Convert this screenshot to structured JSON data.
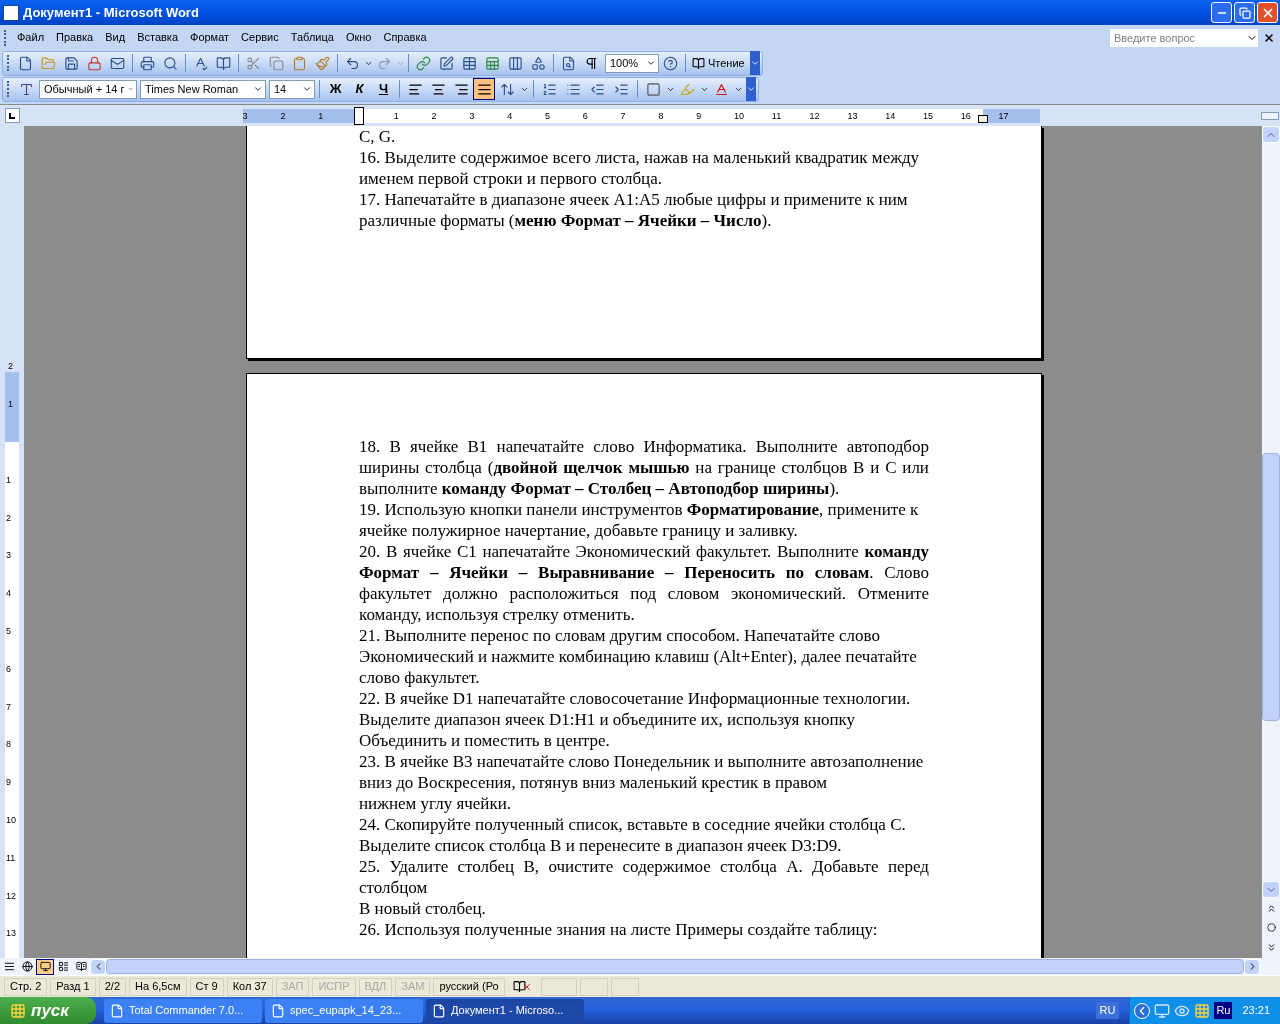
{
  "window": {
    "title": "Документ1 - Microsoft Word"
  },
  "menu": [
    "Файл",
    "Правка",
    "Вид",
    "Вставка",
    "Формат",
    "Сервис",
    "Таблица",
    "Окно",
    "Справка"
  ],
  "help_search": {
    "placeholder": "Введите вопрос"
  },
  "standard_toolbar": {
    "zoom": "100%",
    "reading_button": "Чтение"
  },
  "formatting_toolbar": {
    "style": "Обычный + 14 г",
    "font": "Times New Roman",
    "size": "14",
    "bold": "Ж",
    "italic": "К",
    "underline": "Ч",
    "align_buttons": [
      {
        "selected": false
      },
      {
        "selected": false
      },
      {
        "selected": false
      },
      {
        "selected": true
      }
    ]
  },
  "ruler": {
    "left_labels": [
      "3",
      "2",
      "1"
    ],
    "right_labels": [
      "1",
      "2",
      "3",
      "4",
      "5",
      "6",
      "7",
      "8",
      "9",
      "10",
      "11",
      "12",
      "13",
      "14",
      "15",
      "16",
      "17"
    ]
  },
  "vertical_ruler": {
    "top_labels": [
      "2",
      "1"
    ],
    "bottom_labels": [
      "1",
      "2",
      "3",
      "4",
      "5",
      "6",
      "7",
      "8",
      "9",
      "10",
      "11",
      "12",
      "13"
    ]
  },
  "pages": [
    {
      "paragraphs": [
        {
          "text": "C, G."
        },
        {
          "text": "16. Выделите содержимое всего листа, нажав на маленький квадратик между именем первой строки и первого столбца.",
          "justified": false
        },
        {
          "text": "17. Напечатайте в диапазоне ячеек A1:A5 любые цифры и примените к ним различные форматы (**меню Формат – Ячейки – Число**).",
          "justified": false
        }
      ]
    },
    {
      "paragraphs": [
        {
          "text": "18. В ячейке B1 напечатайте слово Информатика. Выполните автоподбор ширины столбца (**двойной щелчок мышью** на границе столбцов B и C или выполните **команду Формат – Столбец – Автоподбор ширины**).",
          "justified": true
        },
        {
          "text": "19. Использую кнопки панели инструментов **Форматирование**, примените к ячейке полужирное начертание, добавьте границу и заливку.",
          "justified": false
        },
        {
          "text": "20. В ячейке C1 напечатайте Экономический факультет. Выполните **команду Формат – Ячейки – Выравнивание – Переносить по словам**. Слово факультет должно расположиться под словом экономический. Отмените команду, используя стрелку отменить.",
          "justified": true
        },
        {
          "text": "21. Выполните перенос по словам другим способом. Напечатайте слово Экономический и нажмите комбинацию клавиш (Alt+Enter), далее печатайте слово факультет.",
          "justified": false
        },
        {
          "text": "22. В ячейке D1 напечатайте словосочетание Информационные технологии. Выделите диапазон ячеек D1:H1 и объедините их, используя кнопку Объединить и поместить в центре.",
          "justified": false
        },
        {
          "text": "23. В ячейке B3 напечатайте слово Понедельник и выполните автозаполнение вниз до Воскресения, потянув вниз маленький крестик в правом",
          "justified": false
        },
        {
          "text": "нижнем углу ячейки."
        },
        {
          "text": "24. Скопируйте полученный список, вставьте в соседние ячейки столбца C. Выделите список столбца B и перенесите в диапазон ячеек D3:D9.",
          "justified": false
        },
        {
          "text": "25. Удалите столбец B, очистите содержимое столбца А. Добавьте перед столбцом",
          "justified": true
        },
        {
          "text": "В новый столбец."
        },
        {
          "text": "26. Используя полученные знания на листе Примеры создайте таблицу:"
        }
      ]
    }
  ],
  "view_buttons": [
    {
      "selected": false
    },
    {
      "selected": false
    },
    {
      "selected": true
    },
    {
      "selected": false
    },
    {
      "selected": false
    }
  ],
  "status_bar": {
    "fields": [
      {
        "text": "Стр. 2",
        "disabled": false
      },
      {
        "text": "Разд 1",
        "disabled": false
      },
      {
        "text": "2/2",
        "disabled": false
      },
      {
        "text": "На 6,5см",
        "disabled": false
      },
      {
        "text": "Ст 9",
        "disabled": false
      },
      {
        "text": "Кол 37",
        "disabled": false
      },
      {
        "text": "ЗАП",
        "disabled": true
      },
      {
        "text": "ИСПР",
        "disabled": true
      },
      {
        "text": "ВДЛ",
        "disabled": true
      },
      {
        "text": "ЗАМ",
        "disabled": true
      },
      {
        "text": "русский (Ро",
        "disabled": false
      }
    ]
  },
  "taskbar": {
    "start": "пуск",
    "tasks": [
      {
        "label": "Total Commander 7.0...",
        "selected": false
      },
      {
        "label": "spec_eupapk_14_23...",
        "selected": false
      },
      {
        "label": "Документ1 - Microso...",
        "selected": true
      }
    ],
    "language": "RU",
    "keyboard": "Ru",
    "clock": "23:21"
  }
}
